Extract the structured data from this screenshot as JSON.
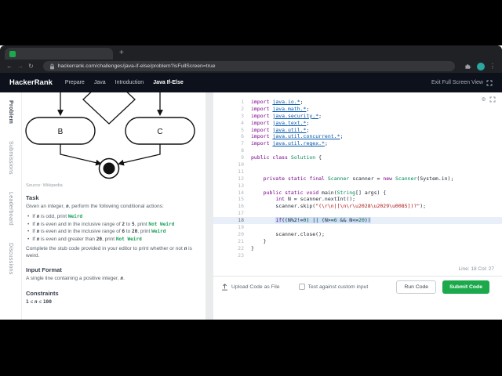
{
  "colors": {
    "brand_green": "#1ba94c",
    "header_bg": "#0c111b",
    "editor_selection": "#cadef5"
  },
  "browser": {
    "url": "hackerrank.com/challenges/java-if-else/problem?isFullScreen=true",
    "icons": {
      "back": "←",
      "forward": "→",
      "reload": "↻",
      "menu": "⋮"
    }
  },
  "header": {
    "logo": "HackerRank",
    "nav": [
      "Prepare",
      "Java",
      "Introduction",
      "Java If-Else"
    ],
    "exit_label": "Exit Full Screen View"
  },
  "side_tabs": [
    {
      "label": "Problem",
      "active": true
    },
    {
      "label": "Submissions",
      "active": false
    },
    {
      "label": "Leaderboard",
      "active": false
    },
    {
      "label": "Discussions",
      "active": false
    }
  ],
  "problem": {
    "flowchart": {
      "node_b": "B",
      "node_c": "C"
    },
    "source": "Source: Wikipedia",
    "task_heading": "Task",
    "intro": [
      [
        "p",
        "Given an integer, "
      ],
      [
        "n",
        "n"
      ],
      [
        "p",
        ", perform the following conditional actions:"
      ]
    ],
    "conditions": [
      [
        [
          "p",
          "If "
        ],
        [
          "n",
          "n"
        ],
        [
          "p",
          " is odd, print "
        ],
        [
          "g",
          "Weird"
        ]
      ],
      [
        [
          "p",
          "If "
        ],
        [
          "n",
          "n"
        ],
        [
          "p",
          " is even and in the inclusive range of "
        ],
        [
          "b",
          "2"
        ],
        [
          "p",
          " to "
        ],
        [
          "b",
          "5"
        ],
        [
          "p",
          ", print "
        ],
        [
          "g",
          "Not Weird"
        ]
      ],
      [
        [
          "p",
          "If "
        ],
        [
          "n",
          "n"
        ],
        [
          "p",
          " is even and in the inclusive range of "
        ],
        [
          "b",
          "6"
        ],
        [
          "p",
          " to "
        ],
        [
          "b",
          "20"
        ],
        [
          "p",
          ", print "
        ],
        [
          "g",
          "Weird"
        ]
      ],
      [
        [
          "p",
          "If "
        ],
        [
          "n",
          "n"
        ],
        [
          "p",
          " is even and greater than "
        ],
        [
          "b",
          "20"
        ],
        [
          "p",
          ", print "
        ],
        [
          "g",
          "Not Weird"
        ]
      ]
    ],
    "closing": [
      [
        "p",
        "Complete the stub code provided in your editor to print whether or not "
      ],
      [
        "n",
        "n"
      ],
      [
        "p",
        " is weird."
      ]
    ],
    "input_heading": "Input Format",
    "input_text": [
      [
        "p",
        "A single line containing a positive integer, "
      ],
      [
        "n",
        "n"
      ],
      [
        "p",
        "."
      ]
    ],
    "constraints_heading": "Constraints",
    "constraints_text": [
      [
        "b",
        "1"
      ],
      [
        "p",
        " ≤ "
      ],
      [
        "n",
        "n"
      ],
      [
        "p",
        " ≤ "
      ],
      [
        "b",
        "100"
      ]
    ]
  },
  "editor": {
    "gear_icon": "⚙",
    "status": "Line: 18 Col: 27",
    "lines": [
      {
        "t": [
          [
            "k",
            "import"
          ],
          [
            "v",
            " "
          ],
          [
            "d",
            "java.io.*"
          ],
          [
            "v",
            ";"
          ]
        ]
      },
      {
        "t": [
          [
            "k",
            "import"
          ],
          [
            "v",
            " "
          ],
          [
            "d",
            "java.math.*"
          ],
          [
            "v",
            ";"
          ]
        ]
      },
      {
        "t": [
          [
            "k",
            "import"
          ],
          [
            "v",
            " "
          ],
          [
            "d",
            "java.security.*"
          ],
          [
            "v",
            ";"
          ]
        ]
      },
      {
        "t": [
          [
            "k",
            "import"
          ],
          [
            "v",
            " "
          ],
          [
            "d",
            "java.text.*"
          ],
          [
            "v",
            ";"
          ]
        ]
      },
      {
        "t": [
          [
            "k",
            "import"
          ],
          [
            "v",
            " "
          ],
          [
            "d",
            "java.util.*"
          ],
          [
            "v",
            ";"
          ]
        ]
      },
      {
        "t": [
          [
            "k",
            "import"
          ],
          [
            "v",
            " "
          ],
          [
            "d",
            "java.util.concurrent.*"
          ],
          [
            "v",
            ";"
          ]
        ]
      },
      {
        "t": [
          [
            "k",
            "import"
          ],
          [
            "v",
            " "
          ],
          [
            "d",
            "java.util.regex.*"
          ],
          [
            "v",
            ";"
          ]
        ]
      },
      {
        "t": []
      },
      {
        "t": [
          [
            "k",
            "public"
          ],
          [
            "v",
            " "
          ],
          [
            "k",
            "class"
          ],
          [
            "v",
            " "
          ],
          [
            "t",
            "Solution"
          ],
          [
            "v",
            " {"
          ]
        ]
      },
      {
        "t": []
      },
      {
        "t": []
      },
      {
        "t": [
          [
            "v",
            "    "
          ],
          [
            "k",
            "private"
          ],
          [
            "v",
            " "
          ],
          [
            "k",
            "static"
          ],
          [
            "v",
            " "
          ],
          [
            "k",
            "final"
          ],
          [
            "v",
            " "
          ],
          [
            "t",
            "Scanner"
          ],
          [
            "v",
            " scanner = "
          ],
          [
            "k",
            "new"
          ],
          [
            "v",
            " "
          ],
          [
            "t",
            "Scanner"
          ],
          [
            "v",
            "(System.in);"
          ]
        ]
      },
      {
        "t": []
      },
      {
        "t": [
          [
            "v",
            "    "
          ],
          [
            "k",
            "public"
          ],
          [
            "v",
            " "
          ],
          [
            "k",
            "static"
          ],
          [
            "v",
            " "
          ],
          [
            "k",
            "void"
          ],
          [
            "v",
            " main("
          ],
          [
            "t",
            "String"
          ],
          [
            "v",
            "[] args) {"
          ]
        ]
      },
      {
        "t": [
          [
            "v",
            "        "
          ],
          [
            "k",
            "int"
          ],
          [
            "v",
            " N = scanner.nextInt();"
          ]
        ]
      },
      {
        "t": [
          [
            "v",
            "        scanner.skip("
          ],
          [
            "s",
            "\"(\\r\\n|[\\n\\r\\u2028\\u2029\\u0085])?\""
          ],
          [
            "v",
            ");"
          ]
        ]
      },
      {
        "t": []
      },
      {
        "t": [
          [
            "v",
            "        "
          ],
          [
            "k",
            "if"
          ],
          [
            "v",
            "((N%2!="
          ],
          [
            "n",
            "0"
          ],
          [
            "v",
            ") || (N>="
          ],
          [
            "n",
            "6"
          ],
          [
            "v",
            " && N<="
          ],
          [
            "n",
            "20"
          ],
          [
            "v",
            "))"
          ]
        ],
        "a": true
      },
      {
        "t": []
      },
      {
        "t": [
          [
            "v",
            "        scanner.close();"
          ]
        ]
      },
      {
        "t": [
          [
            "v",
            "    }"
          ]
        ]
      },
      {
        "t": [
          [
            "v",
            "}"
          ]
        ]
      },
      {
        "t": []
      }
    ]
  },
  "footer": {
    "upload_label": "Upload Code as File",
    "custom_input_label": "Test against custom input",
    "run_label": "Run Code",
    "submit_label": "Submit Code"
  }
}
